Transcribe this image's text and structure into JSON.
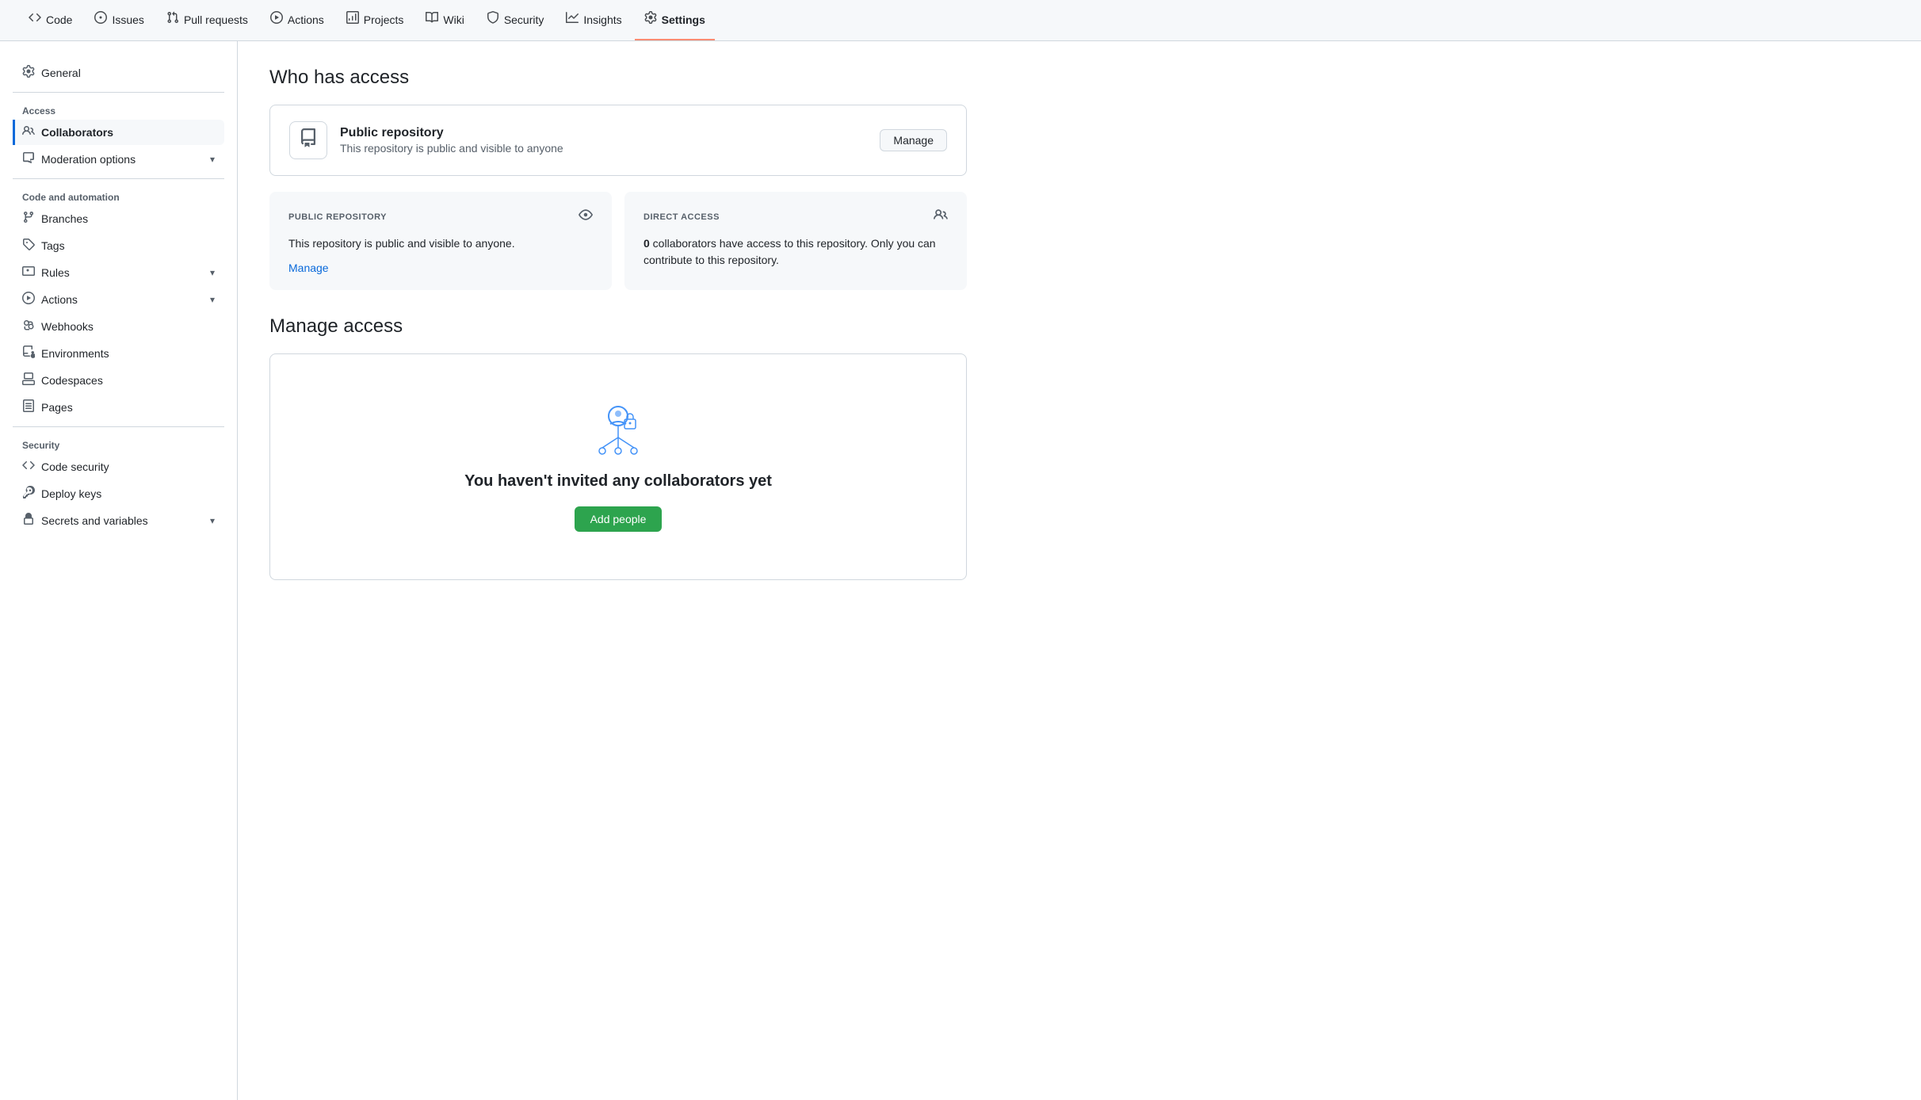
{
  "nav": {
    "items": [
      {
        "id": "code",
        "label": "Code",
        "icon": "◇",
        "active": false
      },
      {
        "id": "issues",
        "label": "Issues",
        "icon": "○",
        "active": false
      },
      {
        "id": "pull-requests",
        "label": "Pull requests",
        "icon": "⑃",
        "active": false
      },
      {
        "id": "actions",
        "label": "Actions",
        "icon": "▷",
        "active": false
      },
      {
        "id": "projects",
        "label": "Projects",
        "icon": "▦",
        "active": false
      },
      {
        "id": "wiki",
        "label": "Wiki",
        "icon": "☰",
        "active": false
      },
      {
        "id": "security",
        "label": "Security",
        "icon": "⛉",
        "active": false
      },
      {
        "id": "insights",
        "label": "Insights",
        "icon": "↗",
        "active": false
      },
      {
        "id": "settings",
        "label": "Settings",
        "icon": "⚙",
        "active": true
      }
    ]
  },
  "sidebar": {
    "general_label": "General",
    "sections": [
      {
        "id": "access",
        "label": "Access",
        "items": [
          {
            "id": "collaborators",
            "label": "Collaborators",
            "icon": "person",
            "active": true,
            "has_chevron": false
          },
          {
            "id": "moderation-options",
            "label": "Moderation options",
            "icon": "speech",
            "active": false,
            "has_chevron": true
          }
        ]
      },
      {
        "id": "code-and-automation",
        "label": "Code and automation",
        "items": [
          {
            "id": "branches",
            "label": "Branches",
            "icon": "branch",
            "active": false,
            "has_chevron": false
          },
          {
            "id": "tags",
            "label": "Tags",
            "icon": "tag",
            "active": false,
            "has_chevron": false
          },
          {
            "id": "rules",
            "label": "Rules",
            "icon": "rules",
            "active": false,
            "has_chevron": true
          },
          {
            "id": "actions",
            "label": "Actions",
            "icon": "actions",
            "active": false,
            "has_chevron": true
          },
          {
            "id": "webhooks",
            "label": "Webhooks",
            "icon": "webhook",
            "active": false,
            "has_chevron": false
          },
          {
            "id": "environments",
            "label": "Environments",
            "icon": "env",
            "active": false,
            "has_chevron": false
          },
          {
            "id": "codespaces",
            "label": "Codespaces",
            "icon": "codespaces",
            "active": false,
            "has_chevron": false
          },
          {
            "id": "pages",
            "label": "Pages",
            "icon": "pages",
            "active": false,
            "has_chevron": false
          }
        ]
      },
      {
        "id": "security",
        "label": "Security",
        "items": [
          {
            "id": "code-security",
            "label": "Code security",
            "icon": "codesec",
            "active": false,
            "has_chevron": false
          },
          {
            "id": "deploy-keys",
            "label": "Deploy keys",
            "icon": "key",
            "active": false,
            "has_chevron": false
          },
          {
            "id": "secrets-and-variables",
            "label": "Secrets and variables",
            "icon": "secrets",
            "active": false,
            "has_chevron": true
          }
        ]
      }
    ]
  },
  "main": {
    "who_has_access_title": "Who has access",
    "public_repo": {
      "title": "Public repository",
      "description": "This repository is public and visible to anyone",
      "manage_btn": "Manage"
    },
    "public_panel": {
      "label": "PUBLIC REPOSITORY",
      "text_line1": "This repository is public and",
      "text_line2": "visible to anyone.",
      "link_text": "Manage"
    },
    "direct_panel": {
      "label": "DIRECT ACCESS",
      "text_bold": "0",
      "text_rest": " collaborators have access to this repository. Only you can contribute to this repository."
    },
    "manage_access_title": "Manage access",
    "no_collaborators_title": "You haven't invited any collaborators yet",
    "add_people_btn": "Add people"
  }
}
